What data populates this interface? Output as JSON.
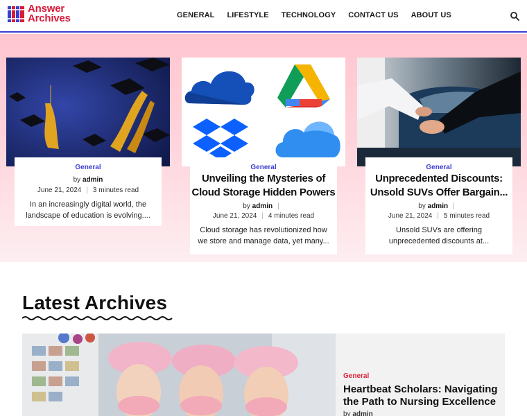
{
  "brand": {
    "line1": "Answer",
    "line2": "Archives"
  },
  "nav": [
    "GENERAL",
    "LIFESTYLE",
    "TECHNOLOGY",
    "CONTACT US",
    "ABOUT US"
  ],
  "cards": [
    {
      "category": "General",
      "title": "",
      "author_prefix": "by",
      "author": "admin",
      "date": "June 21, 2024",
      "read_time": "3 minutes read",
      "excerpt_line1": "In an increasingly digital world, the",
      "excerpt_line2": "landscape of education is evolving...."
    },
    {
      "category": "General",
      "title_line1": "Unveiling the Mysteries of",
      "title_line2": "Cloud Storage Hidden Powers",
      "author_prefix": "by",
      "author": "admin",
      "date": "June 21, 2024",
      "read_time": "4 minutes read",
      "excerpt_line1": "Cloud storage has revolutionized how",
      "excerpt_line2": "we store and manage data, yet many..."
    },
    {
      "category": "General",
      "title_line1": "Unprecedented Discounts:",
      "title_line2": "Unsold SUVs Offer Bargain...",
      "author_prefix": "by",
      "author": "admin",
      "date": "June 21, 2024",
      "read_time": "5 minutes read",
      "excerpt_line1": "Unsold SUVs are offering",
      "excerpt_line2": "unprecedented discounts at..."
    }
  ],
  "latest": {
    "heading": "Latest Archives",
    "feature": {
      "category": "General",
      "title": "Heartbeat Scholars: Navigating the Path to Nursing Excellence",
      "author_prefix": "by",
      "author": "admin"
    }
  },
  "colors": {
    "accent": "#3b3fd1",
    "brand_red": "#d91a3a",
    "hero_pink": "#ffc6d0"
  },
  "icons": {
    "search": "search-icon",
    "logo": "books-icon"
  }
}
